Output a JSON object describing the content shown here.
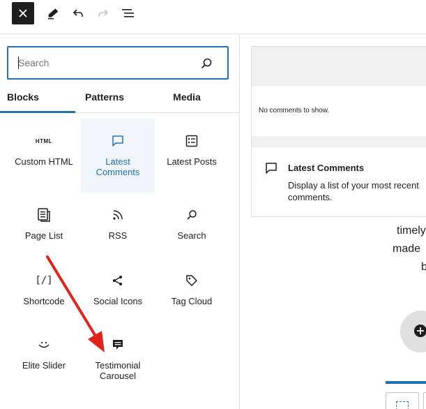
{
  "toolbar": {
    "close_icon": "close-icon",
    "pencil_icon": "pencil-icon",
    "undo_icon": "undo-icon",
    "redo_icon": "redo-icon",
    "list_view_icon": "list-view-icon"
  },
  "inserter": {
    "search": {
      "placeholder": "Search",
      "value": ""
    },
    "tabs": [
      {
        "label": "Blocks",
        "active": true
      },
      {
        "label": "Patterns",
        "active": false
      },
      {
        "label": "Media",
        "active": false
      }
    ],
    "blocks": [
      {
        "label": "Custom HTML",
        "icon": "html-icon",
        "icon_text": "HTML"
      },
      {
        "label": "Latest Comments",
        "icon": "comment-icon",
        "active": true
      },
      {
        "label": "Latest Posts",
        "icon": "list-icon"
      },
      {
        "label": "Page List",
        "icon": "page-list-icon"
      },
      {
        "label": "RSS",
        "icon": "rss-icon"
      },
      {
        "label": "Search",
        "icon": "search-icon"
      },
      {
        "label": "Shortcode",
        "icon": "shortcode-icon",
        "icon_text": "[/]"
      },
      {
        "label": "Social Icons",
        "icon": "share-icon"
      },
      {
        "label": "Tag Cloud",
        "icon": "tag-icon"
      },
      {
        "label": "Elite Slider",
        "icon": "smiley-icon"
      },
      {
        "label": "Testimonial Carousel",
        "icon": "testimonial-icon"
      }
    ]
  },
  "preview": {
    "message": "No comments to show.",
    "block_title": "Latest Comments",
    "block_description": "Display a list of your most recent comments."
  },
  "editor": {
    "text_lines": [
      "timely",
      "made",
      "b"
    ]
  },
  "colors": {
    "accent": "#2271b1",
    "annotation_arrow": "#e2221b",
    "dark": "#1e1e1e"
  }
}
